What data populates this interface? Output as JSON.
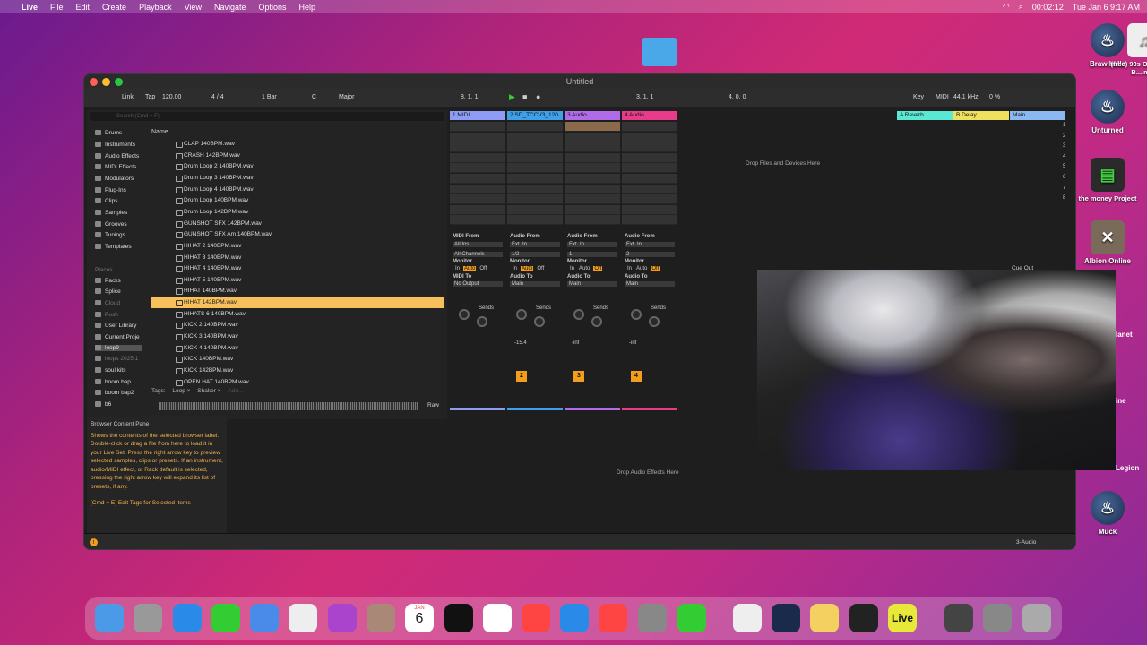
{
  "menubar": {
    "apple": "",
    "app": "Live",
    "items": [
      "File",
      "Edit",
      "Create",
      "Playback",
      "View",
      "Navigate",
      "Options",
      "Help"
    ],
    "timer": "00:02:12",
    "datetime": "Tue Jan 6  9:17 AM"
  },
  "desktop": {
    "icons": [
      {
        "label": "Brawlhalla"
      },
      {
        "label": "(free) 90s Old School B....mp3"
      },
      {
        "label": "Unturned"
      },
      {
        "label": "the money Project"
      },
      {
        "label": "Albion Online"
      },
      {
        "label": "Muck"
      }
    ],
    "partial": [
      "lanet",
      "ine",
      "Legion"
    ]
  },
  "window": {
    "title": "Untitled"
  },
  "control": {
    "link": "Link",
    "tap": "Tap",
    "tempo": "120.00",
    "sig": "4 / 4",
    "quant": "1 Bar",
    "key": "C",
    "scale": "Major",
    "pos1": "8.   1.   1",
    "pos2": "3.   1.   1",
    "pos3": "4.   0.   0",
    "key_label": "Key",
    "midi": "MIDI",
    "rate": "44.1 kHz",
    "cpu": "0 %"
  },
  "browser": {
    "search_placeholder": "Search (Cmd + F)",
    "name_header": "Name",
    "categories": [
      "Drums",
      "Instruments",
      "Audio Effects",
      "MIDI Effects",
      "Modulators",
      "Plug-Ins",
      "Clips",
      "Samples",
      "Grooves",
      "Tunings",
      "Templates"
    ],
    "places_header": "Places",
    "places": [
      "Packs",
      "Splice",
      "Cloud",
      "Push",
      "User Library",
      "Current Proje",
      "loop9",
      "loops 2025 1",
      "soul kits",
      "boom bap",
      "boom bap2",
      "b6"
    ],
    "files": [
      "CLAP 140BPM.wav",
      "CRASH 142BPM.wav",
      "Drum Loop 2 140BPM.wav",
      "Drum Loop 3 140BPM.wav",
      "Drum Loop 4 140BPM.wav",
      "Drum Loop 140BPM.wav",
      "Drum Loop 142BPM.wav",
      "GUNSHOT SFX 142BPM.wav",
      "GUNSHOT SFX Am 140BPM.wav",
      "HIHAT 2 140BPM.wav",
      "HIHAT 3 140BPM.wav",
      "HIHAT 4 140BPM.wav",
      "HIHAT 5 140BPM.wav",
      "HIHAT 140BPM.wav",
      "HIHAT 142BPM.wav",
      "HIHATS 6 140BPM.wav",
      "KICK 2 140BPM.wav",
      "KICK 3 140BPM.wav",
      "KICK 4 140BPM.wav",
      "KICK 140BPM.wav",
      "KICK 142BPM.wav",
      "OPEN HAT 140BPM.wav"
    ],
    "selected_index": 14,
    "tags_label": "Tags:",
    "tag1": "Loop",
    "tag2": "Shaker",
    "tag_add": "Add...",
    "raw": "Raw"
  },
  "tracks": [
    {
      "name": "1 MIDI",
      "color": "#8f9cf6",
      "num": "",
      "io_from": "MIDI From",
      "from": "All Ins",
      "ch": "All Channels",
      "monitor": "Monitor",
      "to_label": "MIDI To",
      "to": "No Output",
      "vol": ""
    },
    {
      "name": "2 SD_TCCV3_120",
      "color": "#3ea0e8",
      "num": "2",
      "io_from": "Audio From",
      "from": "Ext. In",
      "ch": "1/2",
      "monitor": "Monitor",
      "to_label": "Audio To",
      "to": "Main",
      "vol": "-15.4"
    },
    {
      "name": "3 Audio",
      "color": "#b06ce8",
      "num": "3",
      "io_from": "Audio From",
      "from": "Ext. In",
      "ch": "1",
      "monitor": "Monitor",
      "to_label": "Audio To",
      "to": "Main",
      "vol": "-inf"
    },
    {
      "name": "4 Audio",
      "color": "#e83c8a",
      "num": "4",
      "io_from": "Audio From",
      "from": "Ext. In",
      "ch": "2",
      "monitor": "Monitor",
      "to_label": "Audio To",
      "to": "Main",
      "vol": "-inf"
    }
  ],
  "returns": [
    {
      "name": "A Reverb",
      "color": "#5ae8d2"
    },
    {
      "name": "B Delay",
      "color": "#f0e060"
    },
    {
      "name": "Main",
      "color": "#8ab8f0"
    }
  ],
  "scene_numbers": [
    "1",
    "2",
    "3",
    "4",
    "5",
    "6",
    "7",
    "8"
  ],
  "monitor_opts": [
    "In",
    "Auto",
    "Off"
  ],
  "sends": "Sends",
  "drop_devices": "Drop Files and Devices Here",
  "drop_effects": "Drop Audio Effects Here",
  "cue_out": "Cue Out",
  "info": {
    "title": "Browser Content Pane",
    "body": "Shows the contents of the selected browser label. Double-click or drag a file from here to load it in your Live Set. Press the right arrow key to preview selected samples, clips or presets. If an instrument, audio/MIDI effect, or Rack default is selected, pressing the right arrow key will expand its list of presets, if any.",
    "shortcut": "[Cmd + E] Edit Tags for Selected Items"
  },
  "status": {
    "track": "3-Audio"
  },
  "dock": {
    "calendar_month": "JAN",
    "calendar_day": "6",
    "live_label": "Live"
  }
}
